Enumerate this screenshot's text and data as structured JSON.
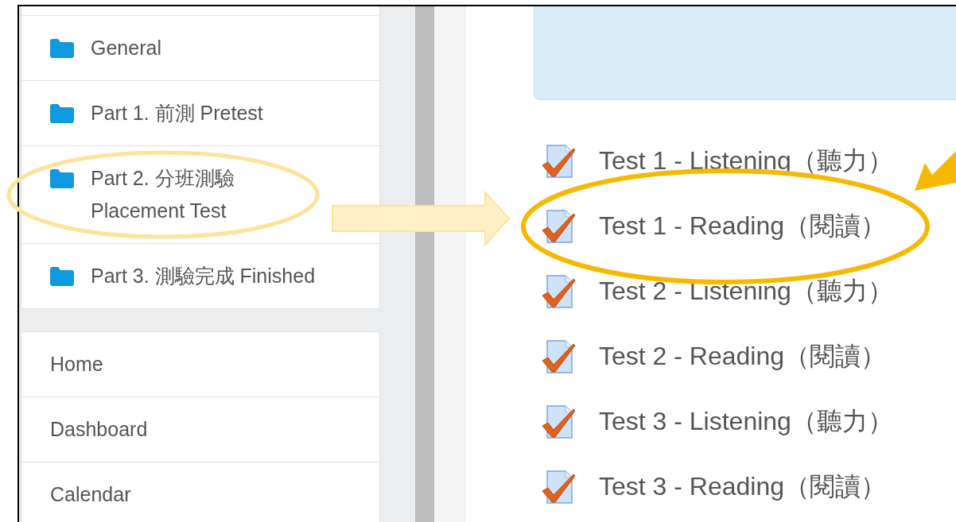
{
  "sections": [
    {
      "label": "General",
      "highlighted": false
    },
    {
      "label": "Part 1. 前測 Pretest",
      "highlighted": false
    },
    {
      "label": "Part 2. 分班測驗 Placement Test",
      "highlighted": true
    },
    {
      "label": "Part 3. 測驗完成 Finished",
      "highlighted": false
    }
  ],
  "nav": [
    {
      "label": "Home"
    },
    {
      "label": "Dashboard"
    },
    {
      "label": "Calendar"
    }
  ],
  "activities": [
    {
      "label": "Test 1 - Listening（聽力）",
      "highlighted": false
    },
    {
      "label": "Test 1 - Reading（閱讀）",
      "highlighted": true
    },
    {
      "label": "Test 2 - Listening（聽力）",
      "highlighted": false
    },
    {
      "label": "Test 2 - Reading（閱讀）",
      "highlighted": false
    },
    {
      "label": "Test 3 - Listening（聽力）",
      "highlighted": false
    },
    {
      "label": "Test 3 - Reading（閱讀）",
      "highlighted": false
    }
  ]
}
